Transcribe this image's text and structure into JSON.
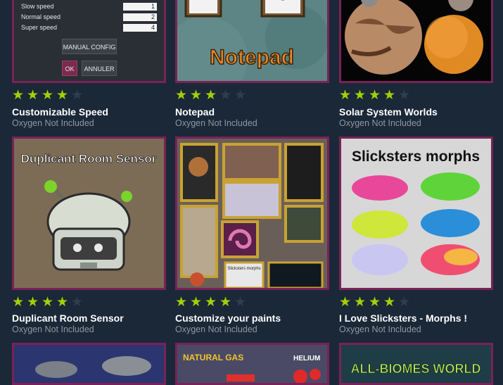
{
  "cards": [
    {
      "title": "Customizable Speed",
      "game": "Oxygen Not Included",
      "rating": 4,
      "thumb": {
        "speeds": [
          {
            "label": "Slow speed",
            "value": "1"
          },
          {
            "label": "Normal speed",
            "value": "2"
          },
          {
            "label": "Super speed",
            "value": "4"
          }
        ],
        "manual_label": "MANUAL CONFIG",
        "ok_label": "OK",
        "cancel_label": "ANNULER"
      }
    },
    {
      "title": "Notepad",
      "game": "Oxygen Not Included",
      "rating": 3,
      "thumb": {
        "caption": "Notepad"
      }
    },
    {
      "title": "Solar System Worlds",
      "game": "Oxygen Not Included",
      "rating": 4
    },
    {
      "title": "Duplicant Room Sensor",
      "game": "Oxygen Not Included",
      "rating": 4,
      "thumb": {
        "caption": "Duplicant Room Sensor"
      }
    },
    {
      "title": "Customize your paints",
      "game": "Oxygen Not Included",
      "rating": 4,
      "thumb": {
        "painting_label": "Slicksters morphs"
      }
    },
    {
      "title": "I Love Slicksters - Morphs !",
      "game": "Oxygen Not Included",
      "rating": 4,
      "thumb": {
        "caption": "Slicksters morphs"
      }
    },
    {
      "thumb": {}
    },
    {
      "thumb": {
        "caption_left": "NATURAL GAS",
        "caption_right": "HELIUM"
      }
    },
    {
      "thumb": {
        "caption": "ALL-BIOMES WORLD"
      }
    }
  ],
  "colors": {
    "background": "#1b2838",
    "star_on": "#a4d007",
    "star_off": "#2f3e4f",
    "frame": "#7a2257"
  }
}
